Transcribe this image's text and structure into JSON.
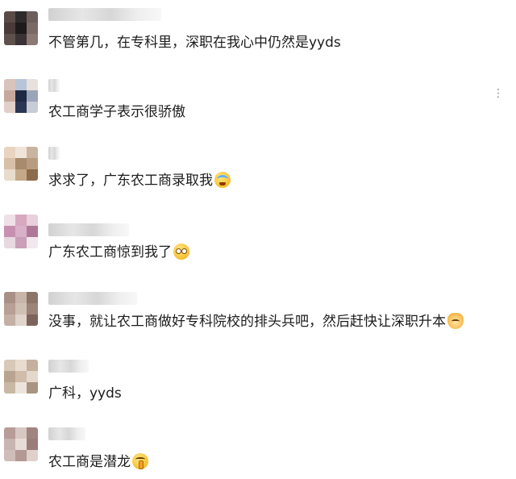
{
  "more_icon": "more-dots-icon",
  "comments": [
    {
      "text": "不管第几，在专科里，深职在我心中仍然是yyds",
      "emoji": null
    },
    {
      "text": "农工商学子表示很骄傲",
      "emoji": null
    },
    {
      "text": "求求了，广东农工商录取我",
      "emoji": "crying-face-icon"
    },
    {
      "text": "广东农工商惊到我了",
      "emoji": "flushed-face-icon"
    },
    {
      "text": "没事，就让农工商做好专科院校的排头兵吧，然后赶快让深职升本",
      "emoji": "cat-face-icon"
    },
    {
      "text": "广科，yyds",
      "emoji": null
    },
    {
      "text": "农工商是潜龙",
      "emoji": "shushing-face-icon"
    }
  ]
}
